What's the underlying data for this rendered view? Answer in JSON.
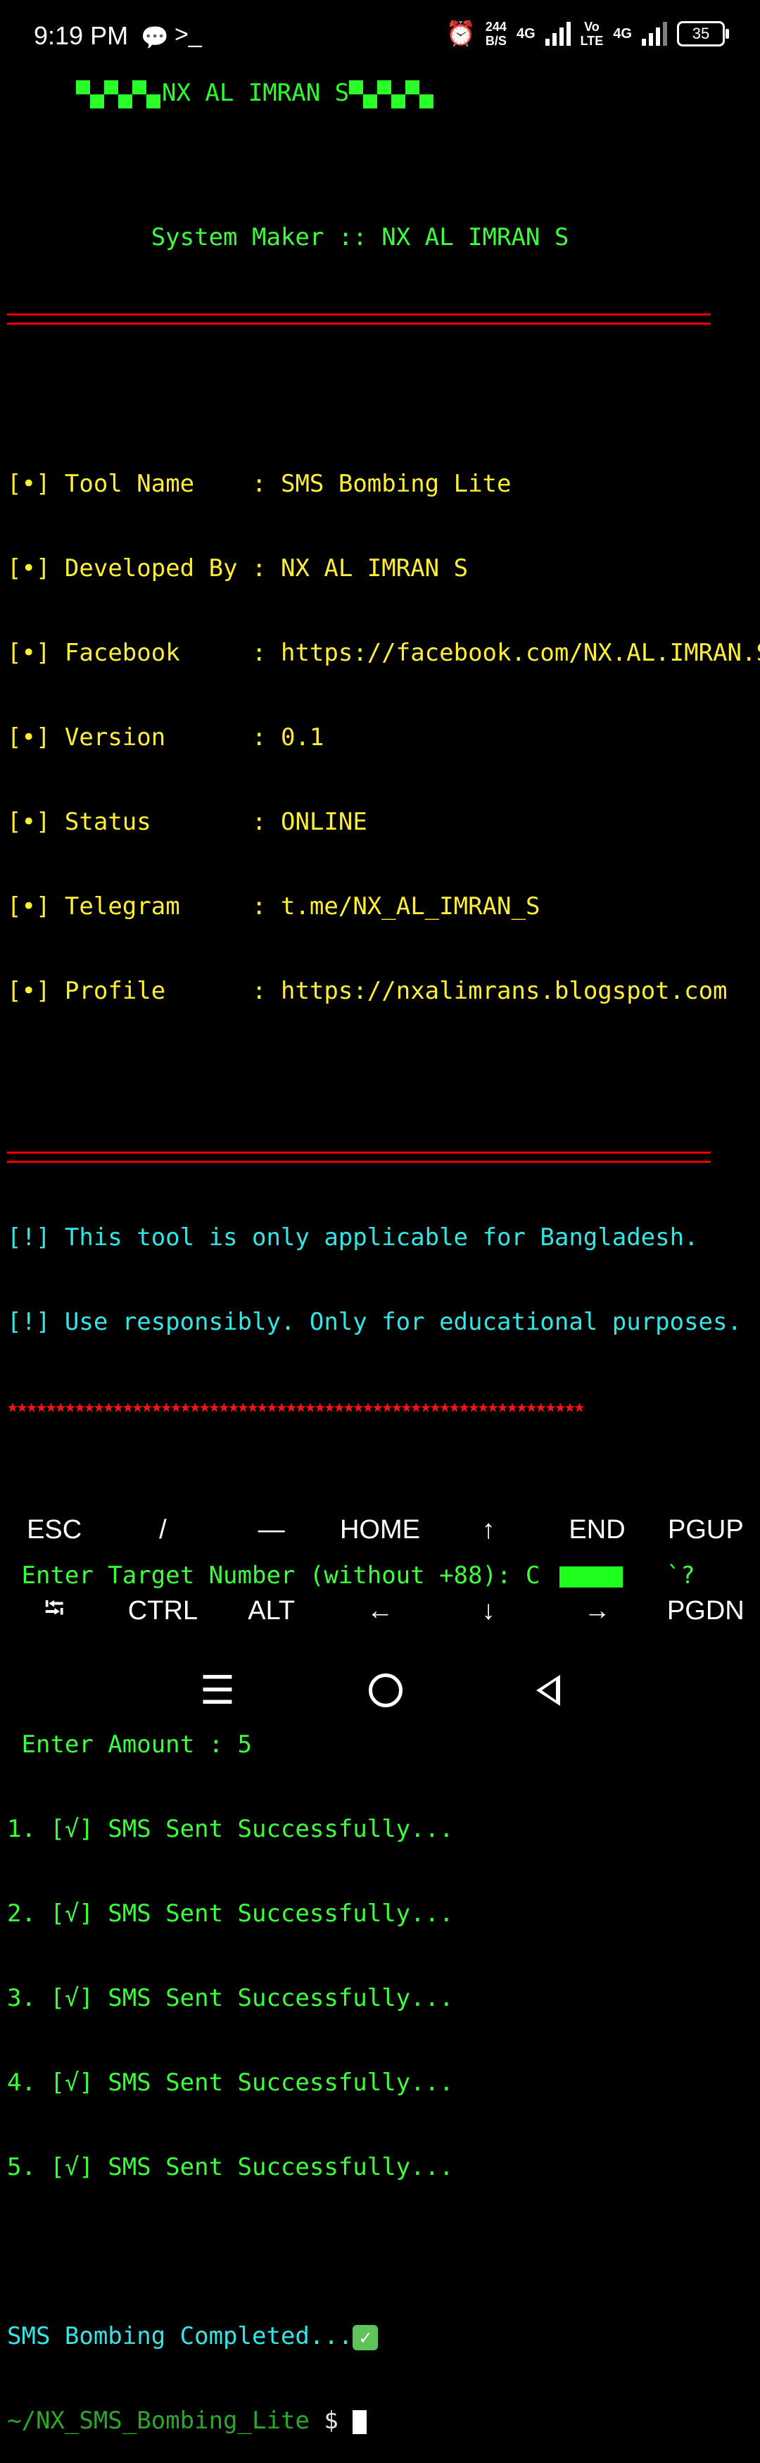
{
  "status_bar": {
    "time": "9:19 PM",
    "speed_value": "244",
    "speed_unit": "B/S",
    "net1": "4G",
    "volte_top": "Vo",
    "volte_bottom": "LTE",
    "net2": "4G",
    "battery": "35"
  },
  "terminal": {
    "banner_name": "NX AL IMRAN S",
    "system_maker": "System Maker :: NX AL IMRAN S",
    "info": [
      {
        "bullet": "[•]",
        "key": "Tool Name   ",
        "sep": " : ",
        "value": "SMS Bombing Lite"
      },
      {
        "bullet": "[•]",
        "key": "Developed By",
        "sep": " : ",
        "value": "NX AL IMRAN S"
      },
      {
        "bullet": "[•]",
        "key": "Facebook    ",
        "sep": " : ",
        "value": "https://facebook.com/NX.AL.IMRAN.S"
      },
      {
        "bullet": "[•]",
        "key": "Version     ",
        "sep": " : ",
        "value": "0.1"
      },
      {
        "bullet": "[•]",
        "key": "Status      ",
        "sep": " : ",
        "value": "ONLINE"
      },
      {
        "bullet": "[•]",
        "key": "Telegram    ",
        "sep": " : ",
        "value": "t.me/NX_AL_IMRAN_S"
      },
      {
        "bullet": "[•]",
        "key": "Profile     ",
        "sep": " : ",
        "value": "https://nxalimrans.blogspot.com"
      }
    ],
    "warning1": "[!] This tool is only applicable for Bangladesh.",
    "warning2": "[!] Use responsibly. Only for educational purposes.",
    "stars": "★★★★★★★★★★★★★★★★★★★★★★★★★★★★★★★★★★★★★★★★★★★★★★★★★★★★★★★★★★★★",
    "target_prompt": " Enter Target Number (without +88): C",
    "target_tail": "`?",
    "amount_prompt": " Enter Amount : 5",
    "results": [
      "1. [√] SMS Sent Successfully...",
      "2. [√] SMS Sent Successfully...",
      "3. [√] SMS Sent Successfully...",
      "4. [√] SMS Sent Successfully...",
      "5. [√] SMS Sent Successfully..."
    ],
    "completed": "SMS Bombing Completed...",
    "prompt_path": "~/NX_SMS_Bombing_Lite",
    "prompt_symbol": " $ "
  },
  "extra_keys": {
    "row1": [
      "ESC",
      "/",
      "—",
      "HOME",
      "↑",
      "END",
      "PGUP"
    ],
    "row2": [
      "⭾",
      "CTRL",
      "ALT",
      "←",
      "↓",
      "→",
      "PGDN"
    ]
  },
  "colors": {
    "green": "#22dd22",
    "yellow": "#ffee33",
    "cyan": "#33e6e6",
    "red": "#ff1111"
  }
}
